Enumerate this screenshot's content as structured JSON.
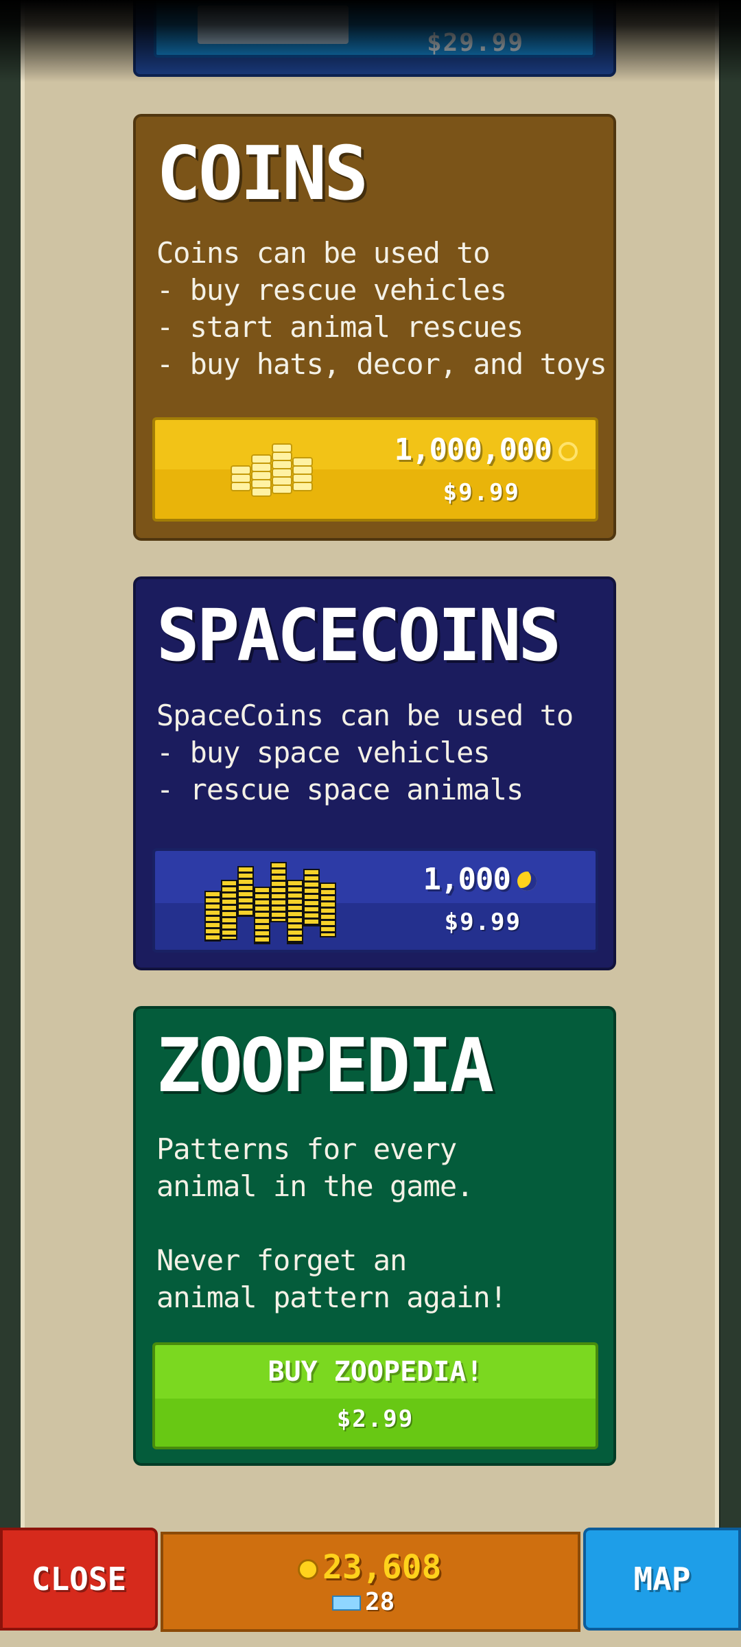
{
  "top_card": {
    "price": "$29.99"
  },
  "coins": {
    "title": "COINS",
    "description": "Coins can be used to\n- buy rescue vehicles\n- start animal rescues\n- buy hats, decor, and toys",
    "amount": "1,000,000",
    "price": "$9.99",
    "icon": "coin-pile-icon"
  },
  "spacecoins": {
    "title": "SPACECOINS",
    "description": "SpaceCoins can be used to\n- buy space vehicles\n- rescue space animals",
    "amount": "1,000",
    "price": "$9.99",
    "icon": "spacecoin-stacks-icon"
  },
  "zoopedia": {
    "title": "ZOOPEDIA",
    "description": "Patterns for every\nanimal in the game.\n\nNever forget an\nanimal pattern again!",
    "button_label": "BUY ZOOPEDIA!",
    "price": "$2.99"
  },
  "bottom_bar": {
    "close_label": "CLOSE",
    "map_label": "MAP",
    "coin_balance": "23,608",
    "gem_balance": "28"
  }
}
